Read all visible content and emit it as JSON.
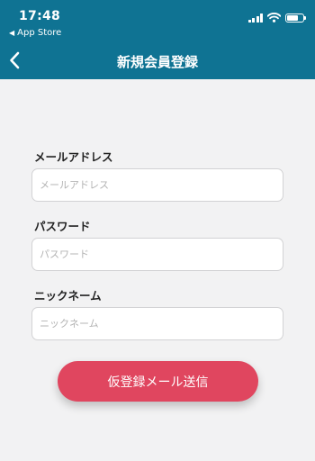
{
  "status_bar": {
    "time": "17:48",
    "back_app": "App Store"
  },
  "nav": {
    "title": "新規会員登録"
  },
  "form": {
    "email": {
      "label": "メールアドレス",
      "placeholder": "メールアドレス",
      "value": ""
    },
    "password": {
      "label": "パスワード",
      "placeholder": "パスワード",
      "value": ""
    },
    "nickname": {
      "label": "ニックネーム",
      "placeholder": "ニックネーム",
      "value": ""
    },
    "submit_label": "仮登録メール送信"
  },
  "colors": {
    "header": "#0f7393",
    "background": "#f2f2f3",
    "button": "#e0465f"
  }
}
